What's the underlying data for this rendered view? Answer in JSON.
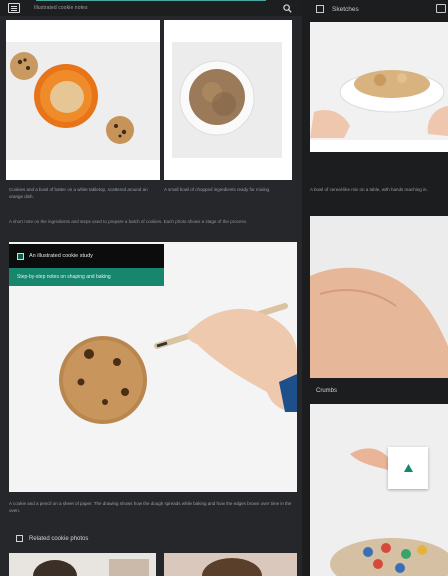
{
  "header": {
    "title": "Illustrated cookie notes",
    "search_icon": "search-icon"
  },
  "cards": {
    "card1_caption": "Cookies and a bowl of batter on a white tabletop, scattered around an orange dish.",
    "card2_caption": "A small bowl of chopped ingredients ready for mixing.",
    "intro_text": "A short note on the ingredients and steps used to prepare a batch of cookies. Each photo shows a stage of the process."
  },
  "feature": {
    "banner_title": "An illustrated cookie study",
    "banner_subtitle": "Step-by-step notes on shaping and baking",
    "caption": "A cookie and a pencil on a sheet of paper. The drawing shows how the dough spreads while baking and how the edges brown over time in the oven."
  },
  "sections": {
    "related_title": "Related cookie photos"
  },
  "sidebar": {
    "title": "Sketches",
    "caption": "A bowl of cereal-like mix on a table, with hands reaching in.",
    "section_label": "Crumbs"
  },
  "colors": {
    "accent": "#16876d",
    "banner": "#0c0c0c",
    "background": "#25272a",
    "sidebar": "#1c1d1f"
  }
}
